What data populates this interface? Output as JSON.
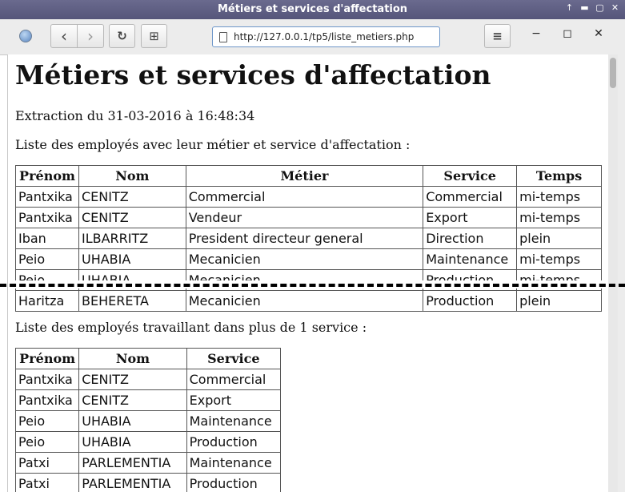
{
  "window": {
    "title": "Métiers et services d'affectation",
    "controls": [
      "↑",
      "▬",
      "▢",
      "✕"
    ]
  },
  "toolbar": {
    "back_icon": "‹",
    "forward_icon": "›",
    "reload_icon": "↻",
    "newtab_icon": "⊞",
    "menu_icon": "≡",
    "minimize_icon": "−",
    "maximize_icon": "◻",
    "close_icon": "✕",
    "url": "http://127.0.0.1/tp5/liste_metiers.php"
  },
  "page": {
    "heading": "Métiers et services d'affectation",
    "extraction": "Extraction du 31-03-2016 à 16:48:34",
    "list1_caption": "Liste des employés avec leur métier et service d'affectation :",
    "list2_caption": "Liste des employés travaillant dans plus de 1 service :"
  },
  "table1": {
    "headers": [
      "Prénom",
      "Nom",
      "Métier",
      "Service",
      "Temps"
    ],
    "rows": [
      [
        "Pantxika",
        "CENITZ",
        "Commercial",
        "Commercial",
        "mi-temps"
      ],
      [
        "Pantxika",
        "CENITZ",
        "Vendeur",
        "Export",
        "mi-temps"
      ],
      [
        "Iban",
        "ILBARRITZ",
        "President directeur general",
        "Direction",
        "plein"
      ],
      [
        "Peio",
        "UHABIA",
        "Mecanicien",
        "Maintenance",
        "mi-temps"
      ],
      [
        "Peio",
        "UHABIA",
        "Mecanicien",
        "Production",
        "mi-temps"
      ],
      [
        "Haritza",
        "BEHERETA",
        "Mecanicien",
        "Production",
        "plein"
      ]
    ]
  },
  "table2": {
    "headers": [
      "Prénom",
      "Nom",
      "Service"
    ],
    "rows": [
      [
        "Pantxika",
        "CENITZ",
        "Commercial"
      ],
      [
        "Pantxika",
        "CENITZ",
        "Export"
      ],
      [
        "Peio",
        "UHABIA",
        "Maintenance"
      ],
      [
        "Peio",
        "UHABIA",
        "Production"
      ],
      [
        "Patxi",
        "PARLEMENTIA",
        "Maintenance"
      ],
      [
        "Patxi",
        "PARLEMENTIA",
        "Production"
      ]
    ]
  }
}
